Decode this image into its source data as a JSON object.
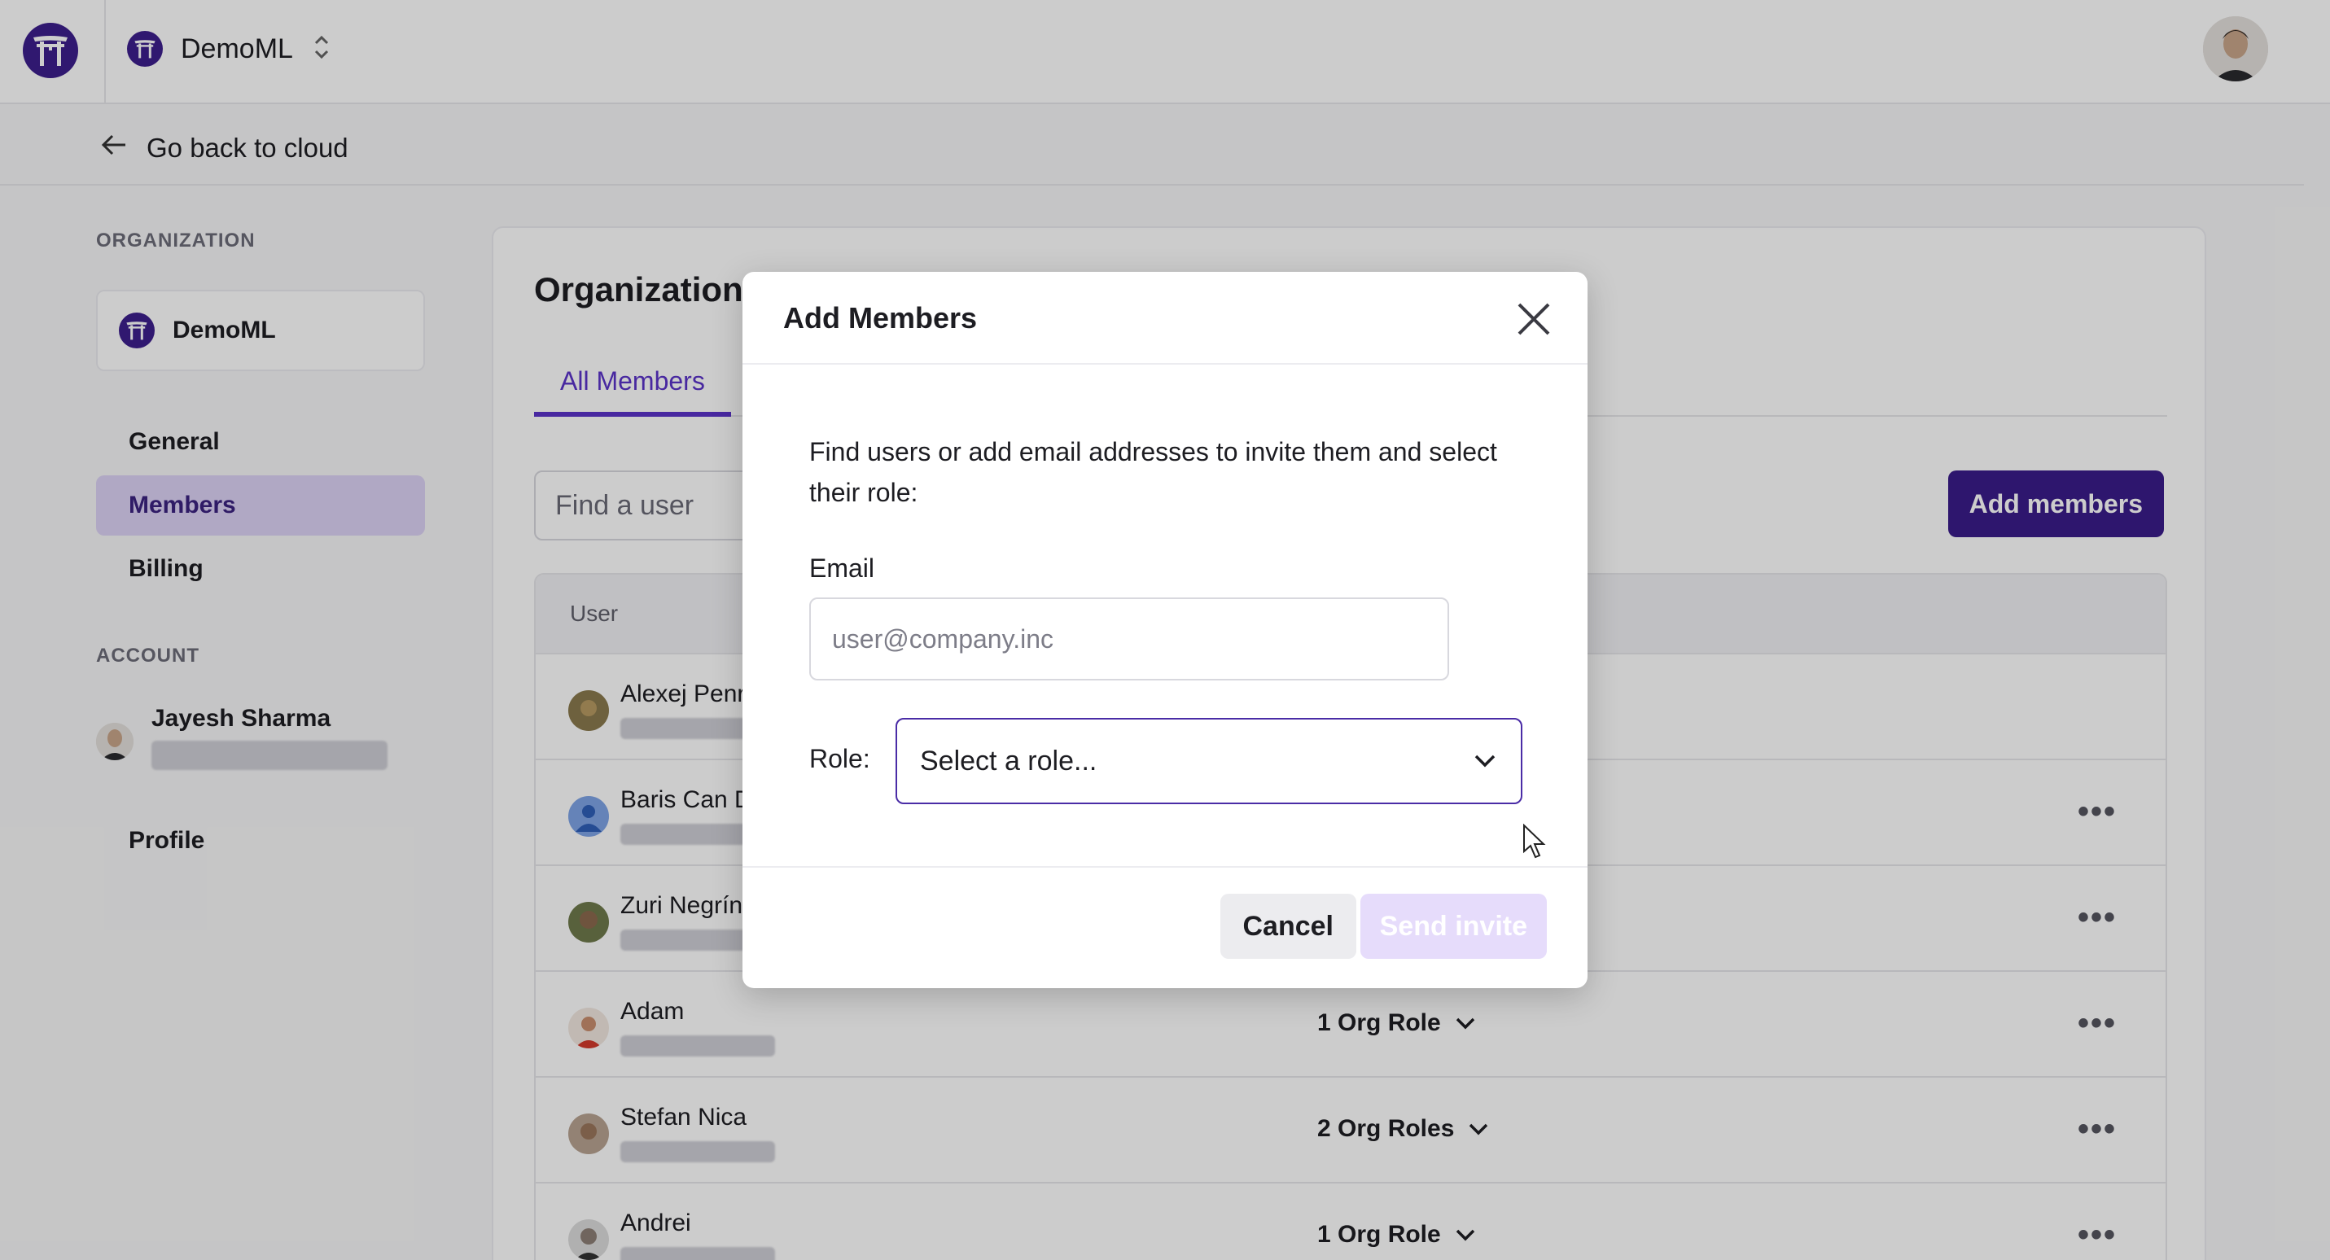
{
  "header": {
    "org_name": "DemoML"
  },
  "back": {
    "label": "Go back to cloud"
  },
  "sidebar": {
    "organization_heading": "ORGANIZATION",
    "org_card_name": "DemoML",
    "nav": [
      {
        "label": "General"
      },
      {
        "label": "Members"
      },
      {
        "label": "Billing"
      }
    ],
    "account_heading": "ACCOUNT",
    "account_name": "Jayesh Sharma",
    "profile_label": "Profile"
  },
  "main": {
    "title": "Organization",
    "tab_all_members": "All Members",
    "search_placeholder": "Find a user",
    "add_members_label": "Add members",
    "table_header_user": "User",
    "rows": [
      {
        "name": "Alexej Penr",
        "roles": ""
      },
      {
        "name": "Baris Can D",
        "roles": ""
      },
      {
        "name": "Zuri Negrín",
        "roles": ""
      },
      {
        "name": "Adam",
        "roles": "1 Org Role"
      },
      {
        "name": "Stefan Nica",
        "roles": "2 Org Roles"
      },
      {
        "name": "Andrei",
        "roles": "1 Org Role"
      }
    ]
  },
  "modal": {
    "title": "Add Members",
    "description": "Find users or add email addresses to invite them and select their role:",
    "email_label": "Email",
    "email_placeholder": "user@company.inc",
    "role_label": "Role:",
    "role_placeholder": "Select a role...",
    "cancel_label": "Cancel",
    "send_label": "Send invite"
  },
  "colors": {
    "brand": "#3d1f8c",
    "accent": "#5b33c9",
    "active_nav_bg": "#dcd3f6",
    "send_disabled_bg": "#e6dcfb"
  }
}
